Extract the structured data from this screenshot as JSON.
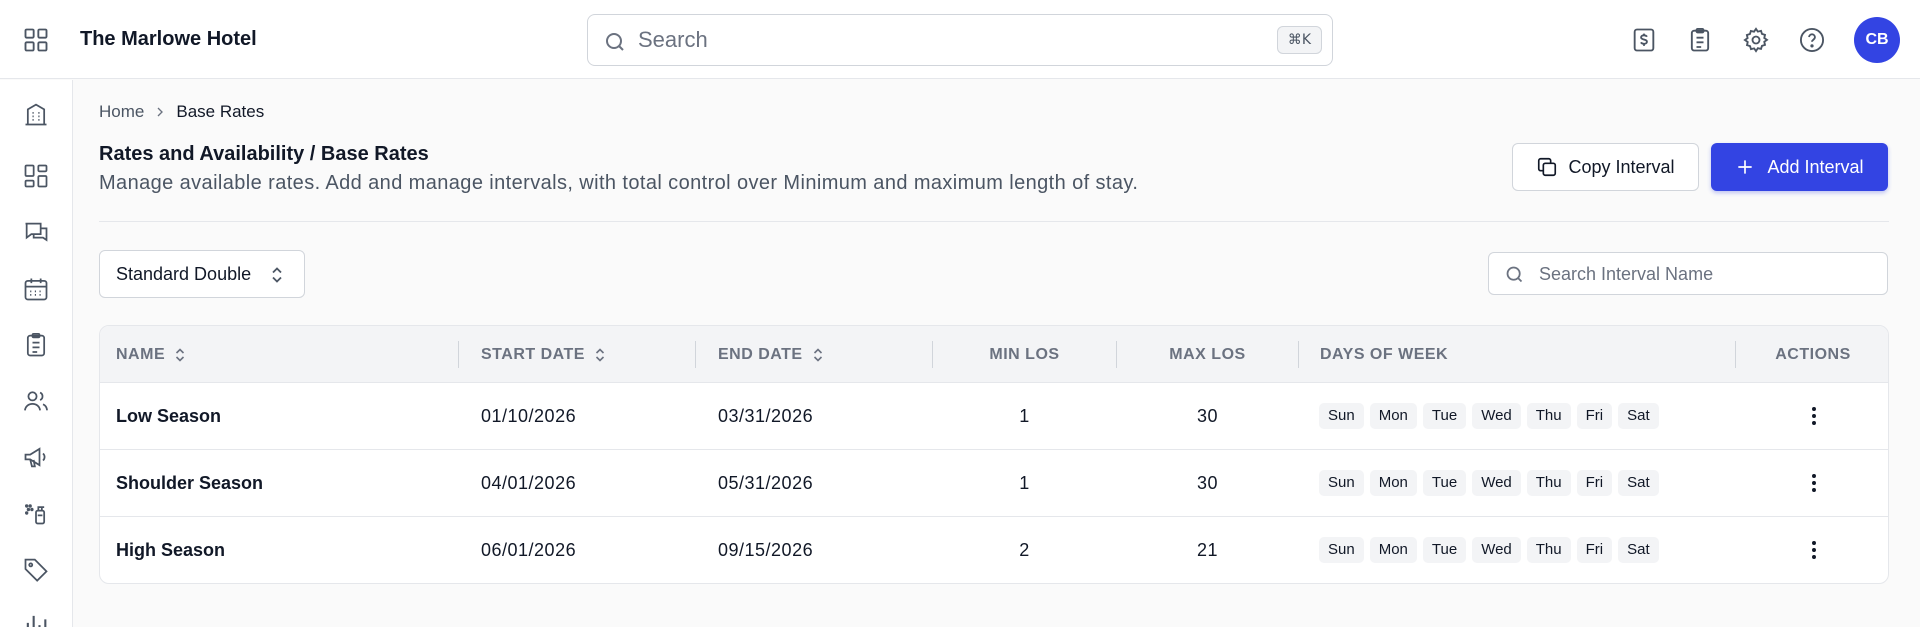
{
  "header": {
    "hotel_name": "The Marlowe Hotel",
    "search_placeholder": "Search",
    "search_shortcut": "⌘K",
    "avatar_initials": "CB",
    "icons": [
      "billing-icon",
      "clipboard-icon",
      "gear-icon",
      "help-icon"
    ]
  },
  "sidebar": {
    "items": [
      "building-icon",
      "dashboard-icon",
      "messages-icon",
      "calendar-icon",
      "clipboard-icon",
      "users-icon",
      "megaphone-icon",
      "housekeeping-icon",
      "tag-icon",
      "chart-icon"
    ]
  },
  "breadcrumb": {
    "home": "Home",
    "current": "Base Rates"
  },
  "page": {
    "title": "Rates and Availability / Base Rates",
    "subtitle": "Manage available rates. Add and manage intervals, with total control over Minimum and maximum length of stay.",
    "copy_button": "Copy Interval",
    "add_button": "Add Interval"
  },
  "filters": {
    "room_type": "Standard Double",
    "interval_search_placeholder": "Search Interval Name"
  },
  "table": {
    "columns": {
      "name": "NAME",
      "start_date": "START DATE",
      "end_date": "END DATE",
      "min_los": "MIN LOS",
      "max_los": "MAX LOS",
      "days_of_week": "DAYS OF WEEK",
      "actions": "ACTIONS"
    },
    "days": [
      "Sun",
      "Mon",
      "Tue",
      "Wed",
      "Thu",
      "Fri",
      "Sat"
    ],
    "rows": [
      {
        "name": "Low Season",
        "start_date": "01/10/2026",
        "end_date": "03/31/2026",
        "min_los": "1",
        "max_los": "30"
      },
      {
        "name": "Shoulder Season",
        "start_date": "04/01/2026",
        "end_date": "05/31/2026",
        "min_los": "1",
        "max_los": "30"
      },
      {
        "name": "High Season",
        "start_date": "06/01/2026",
        "end_date": "09/15/2026",
        "min_los": "2",
        "max_los": "21"
      }
    ]
  },
  "colors": {
    "primary": "#3344e3",
    "border": "#e5e7eb",
    "muted_text": "#6b7280"
  }
}
